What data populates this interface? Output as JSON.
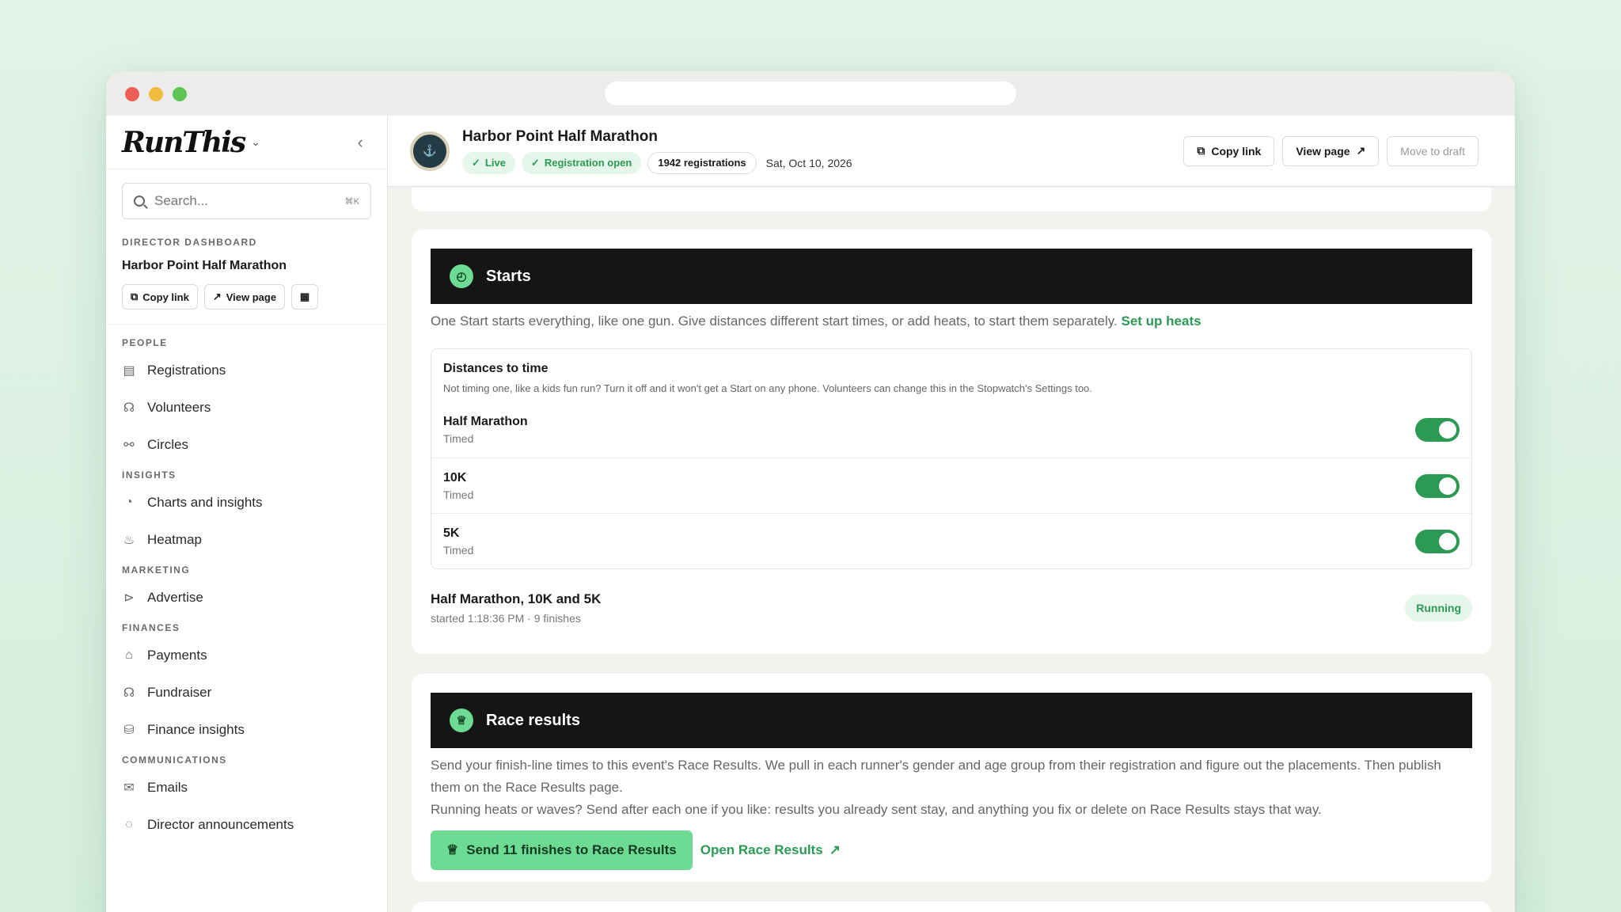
{
  "sidebar": {
    "logo": "RunThis",
    "search_placeholder": "Search...",
    "search_shortcut": "⌘K",
    "dashboard_label": "DIRECTOR DASHBOARD",
    "race_name": "Harbor Point Half Marathon",
    "copy_link": "Copy link",
    "view_page": "View page",
    "sections": [
      {
        "label": "PEOPLE",
        "items": [
          "Registrations",
          "Volunteers",
          "Circles"
        ]
      },
      {
        "label": "INSIGHTS",
        "items": [
          "Charts and insights",
          "Heatmap"
        ]
      },
      {
        "label": "MARKETING",
        "items": [
          "Advertise"
        ]
      },
      {
        "label": "FINANCES",
        "items": [
          "Payments",
          "Fundraiser",
          "Finance insights"
        ]
      },
      {
        "label": "COMMUNICATIONS",
        "items": [
          "Emails",
          "Director announcements"
        ]
      }
    ]
  },
  "header": {
    "title": "Harbor Point Half Marathon",
    "status_live": "Live",
    "status_registration": "Registration open",
    "registrations": "1942 registrations",
    "date": "Sat, Oct 10, 2026",
    "copy_link": "Copy link",
    "view_page": "View page",
    "move_to_draft": "Move to draft"
  },
  "starts": {
    "title": "Starts",
    "description": "One Start starts everything, like one gun. Give distances different start times, or add heats, to start them separately.",
    "setup_link": "Set up heats",
    "distances_title": "Distances to time",
    "distances_subtitle": "Not timing one, like a kids fun run? Turn it off and it won't get a Start on any phone. Volunteers can change this in the Stopwatch's Settings too.",
    "distances": [
      {
        "name": "Half Marathon",
        "state": "Timed"
      },
      {
        "name": "10K",
        "state": "Timed"
      },
      {
        "name": "5K",
        "state": "Timed"
      }
    ],
    "running_title": "Half Marathon, 10K and 5K",
    "running_sub": "started 1:18:36 PM · 9 finishes",
    "running_badge": "Running"
  },
  "results": {
    "title": "Race results",
    "description1": "Send your finish-line times to this event's Race Results. We pull in each runner's gender and age group from their registration and figure out the placements. Then publish them on the Race Results page.",
    "description2": "Running heats or waves? Send after each one if you like: results you already sent stay, and anything you fix or delete on Race Results stays that way.",
    "send_button": "Send 11 finishes to Race Results",
    "open_link": "Open Race Results"
  },
  "colors": {
    "accent": "#2c9a55",
    "accent_light": "#6ddb93",
    "bar": "#151515"
  }
}
